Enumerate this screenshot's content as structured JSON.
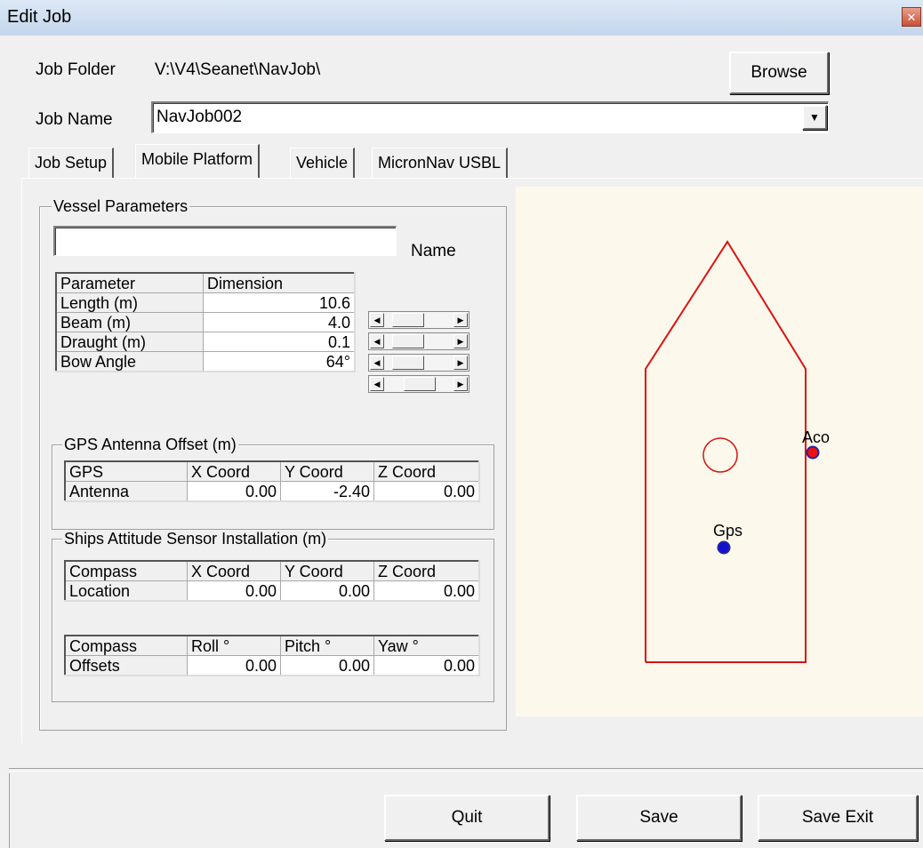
{
  "window": {
    "title": "Edit Job",
    "close_glyph": "✕"
  },
  "job_folder": {
    "label": "Job Folder",
    "value": "V:\\V4\\Seanet\\NavJob\\"
  },
  "browse_label": "Browse",
  "job_name": {
    "label": "Job Name",
    "value": "NavJob002",
    "dropdown_glyph": "▼"
  },
  "tabs": [
    {
      "label": "Job Setup",
      "active": false
    },
    {
      "label": "Mobile Platform",
      "active": true
    },
    {
      "label": "Vehicle",
      "active": false
    },
    {
      "label": "MicronNav USBL",
      "active": false
    }
  ],
  "vessel": {
    "group_label": "Vessel Parameters",
    "name_value": "",
    "name_label": "Name",
    "table": {
      "headers": [
        "Parameter",
        "Dimension"
      ],
      "rows": [
        {
          "param": "Length (m)",
          "value": "10.6",
          "slider": 0.2
        },
        {
          "param": "Beam (m)",
          "value": "4.0",
          "slider": 0.2
        },
        {
          "param": "Draught (m)",
          "value": "0.1",
          "slider": 0.2
        },
        {
          "param": "Bow Angle",
          "value": "64°",
          "slider": 0.5
        }
      ]
    }
  },
  "gps_offset": {
    "group_label": "GPS Antenna Offset (m)",
    "headers": [
      "GPS",
      "X Coord",
      "Y Coord",
      "Z Coord"
    ],
    "row": [
      "Antenna",
      "0.00",
      "-2.40",
      "0.00"
    ]
  },
  "attitude": {
    "group_label": "Ships Attitude Sensor Installation (m)",
    "location": {
      "headers": [
        "Compass",
        "X Coord",
        "Y Coord",
        "Z Coord"
      ],
      "row": [
        "Location",
        "0.00",
        "0.00",
        "0.00"
      ]
    },
    "offsets": {
      "headers": [
        "Compass",
        "Roll °",
        "Pitch °",
        "Yaw °"
      ],
      "row": [
        "Offsets",
        "0.00",
        "0.00",
        "0.00"
      ]
    }
  },
  "canvas": {
    "labels": {
      "aco": "Aco",
      "gps": "Gps"
    },
    "colors": {
      "outline": "#dd1111",
      "aco_dot": "#ee1111",
      "gps_dot": "#1111cc",
      "background": "#fcf9ec"
    }
  },
  "footer": {
    "quit": "Quit",
    "save": "Save",
    "save_exit": "Save Exit"
  }
}
